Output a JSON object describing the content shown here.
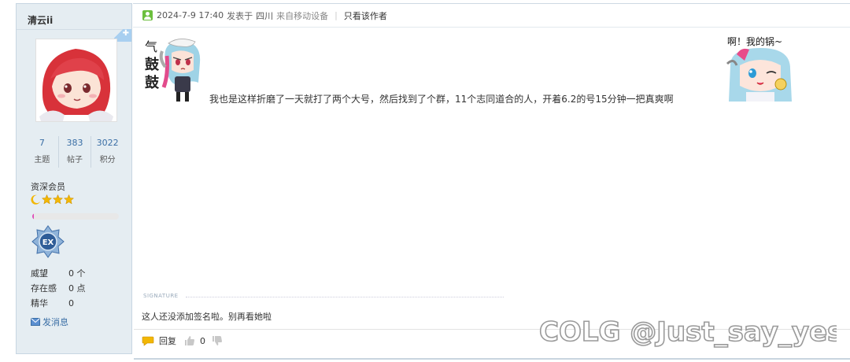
{
  "user": {
    "name": "清云ii",
    "stats": [
      {
        "value": "7",
        "label": "主题"
      },
      {
        "value": "383",
        "label": "帖子"
      },
      {
        "value": "3022",
        "label": "积分"
      }
    ],
    "rank": "资深会员",
    "rank_progress": 0.02,
    "info": [
      {
        "key": "威望",
        "value": "0 个"
      },
      {
        "key": "存在感",
        "value": "0 点"
      },
      {
        "key": "精华",
        "value": "0"
      }
    ],
    "send_message": "发消息",
    "medal_text": "EX"
  },
  "post": {
    "timestamp": "2024-7-9 17:40",
    "posted_in_label": "发表于",
    "location": "四川",
    "device": "来自移动设备",
    "author_only": "只看该作者",
    "body": "我也是这样折磨了一天就打了两个大号，然后找到了个群，11个志同道合的人，开着6.2的号15分钟一把真爽啊",
    "sticker_left_text": [
      "气",
      "鼓",
      "鼓"
    ],
    "sticker_right_text": "啊！我的锅~",
    "signature_label": "SIGNATURE",
    "signature": "这人还没添加签名啦。别再看她啦",
    "reply_label": "回复",
    "like_count": "0"
  },
  "watermark": "COLG @Just_say_yes",
  "colors": {
    "accent_blue": "#3a6ea5",
    "panel_bg": "#e5edf2",
    "progress_pink": "#e04db8",
    "online_green": "#6cbf3e"
  }
}
